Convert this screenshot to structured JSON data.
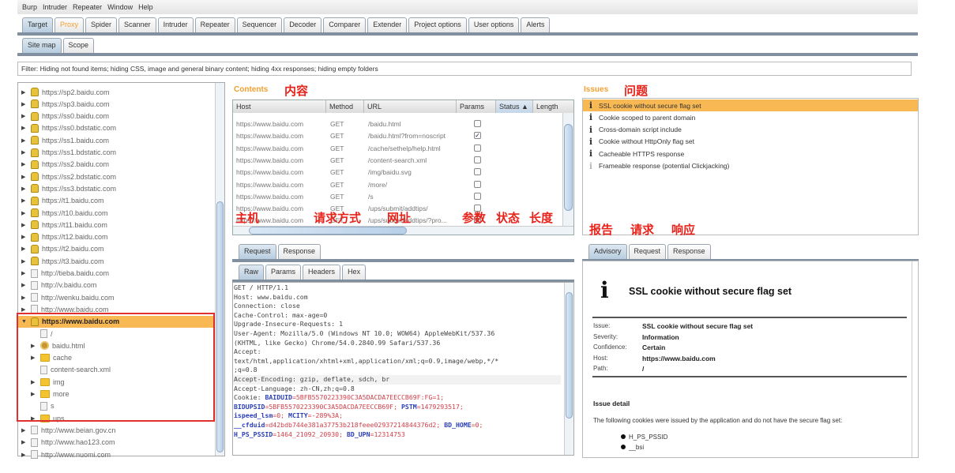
{
  "menu": [
    "Burp",
    "Intruder",
    "Repeater",
    "Window",
    "Help"
  ],
  "main_tabs": [
    {
      "label": "Target",
      "selected": true
    },
    {
      "label": "Proxy",
      "highlight": "#f0a030"
    },
    {
      "label": "Spider"
    },
    {
      "label": "Scanner"
    },
    {
      "label": "Intruder"
    },
    {
      "label": "Repeater"
    },
    {
      "label": "Sequencer"
    },
    {
      "label": "Decoder"
    },
    {
      "label": "Comparer"
    },
    {
      "label": "Extender"
    },
    {
      "label": "Project options"
    },
    {
      "label": "User options"
    },
    {
      "label": "Alerts"
    }
  ],
  "sub_tabs": [
    {
      "label": "Site map",
      "selected": true
    },
    {
      "label": "Scope"
    }
  ],
  "filter": "Filter:  Hiding not found items;  hiding CSS, image and general binary content;  hiding 4xx responses;  hiding empty folders",
  "tree": [
    {
      "label": "https://sp2.baidu.com",
      "icon": "lock"
    },
    {
      "label": "https://sp3.baidu.com",
      "icon": "lock"
    },
    {
      "label": "https://ss0.baidu.com",
      "icon": "lock"
    },
    {
      "label": "https://ss0.bdstatic.com",
      "icon": "lock"
    },
    {
      "label": "https://ss1.baidu.com",
      "icon": "lock"
    },
    {
      "label": "https://ss1.bdstatic.com",
      "icon": "lock"
    },
    {
      "label": "https://ss2.baidu.com",
      "icon": "lock"
    },
    {
      "label": "https://ss2.bdstatic.com",
      "icon": "lock"
    },
    {
      "label": "https://ss3.bdstatic.com",
      "icon": "lock"
    },
    {
      "label": "https://t1.baidu.com",
      "icon": "lock"
    },
    {
      "label": "https://t10.baidu.com",
      "icon": "lock"
    },
    {
      "label": "https://t11.baidu.com",
      "icon": "lock"
    },
    {
      "label": "https://t12.baidu.com",
      "icon": "lock"
    },
    {
      "label": "https://t2.baidu.com",
      "icon": "lock"
    },
    {
      "label": "https://t3.baidu.com",
      "icon": "lock"
    },
    {
      "label": "http://tieba.baidu.com",
      "icon": "page"
    },
    {
      "label": "http://v.baidu.com",
      "icon": "page"
    },
    {
      "label": "http://wenku.baidu.com",
      "icon": "page"
    },
    {
      "label": "http://www.baidu.com",
      "icon": "page"
    },
    {
      "label": "https://www.baidu.com",
      "icon": "lock",
      "selected": true,
      "expanded": true
    },
    {
      "label": "/",
      "icon": "page",
      "child": true,
      "leaf": true
    },
    {
      "label": "baidu.html",
      "icon": "gear",
      "child": true
    },
    {
      "label": "cache",
      "icon": "folder",
      "child": true
    },
    {
      "label": "content-search.xml",
      "icon": "page",
      "child": true,
      "leaf": true
    },
    {
      "label": "img",
      "icon": "folder",
      "child": true
    },
    {
      "label": "more",
      "icon": "folder",
      "child": true
    },
    {
      "label": "s",
      "icon": "page",
      "child": true,
      "leaf": true
    },
    {
      "label": "ups",
      "icon": "folder",
      "child": true
    },
    {
      "label": "http://www.beian.gov.cn",
      "icon": "page"
    },
    {
      "label": "http://www.hao123.com",
      "icon": "page"
    },
    {
      "label": "http://www.nuomi.com",
      "icon": "page"
    }
  ],
  "contents": {
    "label": "Contents",
    "annotation": "内容",
    "columns": [
      "Host",
      "Method",
      "URL",
      "Params",
      "Status ▲",
      "Length"
    ],
    "rows": [
      {
        "host": "https://www.baidu.com",
        "method": "GET",
        "url": "/baidu.html",
        "params": false
      },
      {
        "host": "https://www.baidu.com",
        "method": "GET",
        "url": "/baidu.html?from=noscript",
        "params": true
      },
      {
        "host": "https://www.baidu.com",
        "method": "GET",
        "url": "/cache/sethelp/help.html",
        "params": false
      },
      {
        "host": "https://www.baidu.com",
        "method": "GET",
        "url": "/content-search.xml",
        "params": false
      },
      {
        "host": "https://www.baidu.com",
        "method": "GET",
        "url": "/img/baidu.svg",
        "params": false
      },
      {
        "host": "https://www.baidu.com",
        "method": "GET",
        "url": "/more/",
        "params": false
      },
      {
        "host": "https://www.baidu.com",
        "method": "GET",
        "url": "/s",
        "params": false
      },
      {
        "host": "https://www.baidu.com",
        "method": "GET",
        "url": "/ups/submit/addtips/",
        "params": false
      },
      {
        "host": "https://www.baidu.com",
        "method": "GET",
        "url": "/ups/submit/addtips/?pro...",
        "params": true
      }
    ],
    "annotations": {
      "host": "主机",
      "method": "请求方式",
      "url": "网址",
      "params": "参数",
      "status": "状态",
      "length": "长度"
    }
  },
  "request_tabs": [
    {
      "label": "Request",
      "selected": true
    },
    {
      "label": "Response"
    }
  ],
  "raw_tabs": [
    {
      "label": "Raw",
      "selected": true
    },
    {
      "label": "Params"
    },
    {
      "label": "Headers"
    },
    {
      "label": "Hex"
    }
  ],
  "request_lines": [
    [
      [
        "GET / HTTP/1.1",
        ""
      ]
    ],
    [
      [
        "Host: www.baidu.com",
        ""
      ]
    ],
    [
      [
        "Connection: close",
        ""
      ]
    ],
    [
      [
        "Cache-Control: max-age=0",
        ""
      ]
    ],
    [
      [
        "Upgrade-Insecure-Requests: 1",
        ""
      ]
    ],
    [
      [
        "User-Agent: Mozilla/5.0 (Windows NT 10.0; WOW64) AppleWebKit/537.36",
        ""
      ]
    ],
    [
      [
        "(KHTML, like Gecko) Chrome/54.0.2840.99 Safari/537.36",
        ""
      ]
    ],
    [
      [
        "Accept:",
        ""
      ]
    ],
    [
      [
        "text/html,application/xhtml+xml,application/xml;q=0.9,image/webp,*/*",
        ""
      ]
    ],
    [
      [
        ";q=0.8",
        ""
      ]
    ],
    [
      [
        "Accept-Encoding: gzip, deflate, sdch, br",
        ""
      ]
    ],
    [
      [
        "Accept-Language: zh-CN,zh;q=0.8",
        ""
      ]
    ],
    [
      [
        "Cookie: ",
        ""
      ],
      [
        "BAIDUID",
        "ck"
      ],
      [
        "=5BFB5570223390C3A5DACDA7EECCB69F:FG=1; ",
        "cv"
      ]
    ],
    [
      [
        "BIDUPSID",
        "ck"
      ],
      [
        "=5BFB5570223390C3A5DACDA7EECCB69F; ",
        "cv"
      ],
      [
        "PSTM",
        "ck"
      ],
      [
        "=1479293517;",
        "cv"
      ]
    ],
    [
      [
        "ispeed_lsm",
        "ck"
      ],
      [
        "=0; ",
        "cv"
      ],
      [
        "MCITY",
        "ck"
      ],
      [
        "=-289%3A;",
        "cv"
      ]
    ],
    [
      [
        "__cfduid",
        "ck"
      ],
      [
        "=d42bdb744e381a37753b218feee02937214844376d2; ",
        "cv"
      ],
      [
        "BD_HOME",
        "ck"
      ],
      [
        "=0;",
        "cv"
      ]
    ],
    [
      [
        "H_PS_PSSID",
        "ck"
      ],
      [
        "=1464_21092_20930; ",
        "cv"
      ],
      [
        "BD_UPN",
        "ck"
      ],
      [
        "=12314753",
        "cv"
      ]
    ]
  ],
  "issues": {
    "label": "Issues",
    "annotation": "问题",
    "items": [
      {
        "label": "SSL cookie without secure flag set",
        "selected": true
      },
      {
        "label": "Cookie scoped to parent domain"
      },
      {
        "label": "Cross-domain script include"
      },
      {
        "label": "Cookie without HttpOnly flag set"
      },
      {
        "label": "Cacheable HTTPS response"
      },
      {
        "label": "Frameable response (potential Clickjacking)",
        "faint": true
      }
    ],
    "bottom_annotations": [
      "报告",
      "请求",
      "响应"
    ]
  },
  "advisory_tabs": [
    {
      "label": "Advisory",
      "selected": true
    },
    {
      "label": "Request"
    },
    {
      "label": "Response"
    }
  ],
  "advisory": {
    "title": "SSL cookie without secure flag set",
    "fields": [
      {
        "k": "Issue:",
        "v": "SSL cookie without secure flag set"
      },
      {
        "k": "Severity:",
        "v": "Information"
      },
      {
        "k": "Confidence:",
        "v": "Certain"
      },
      {
        "k": "Host:",
        "v": "https://www.baidu.com"
      },
      {
        "k": "Path:",
        "v": "/"
      }
    ],
    "detail_heading": "Issue detail",
    "detail_text": "The following cookies were issued by the application and do not have the secure flag set:",
    "cookies": [
      "H_PS_PSSID",
      "__bsi"
    ]
  },
  "colors": {
    "accent": "#f0a030",
    "annotation": "#e8231b",
    "selection": "#f8b955"
  }
}
